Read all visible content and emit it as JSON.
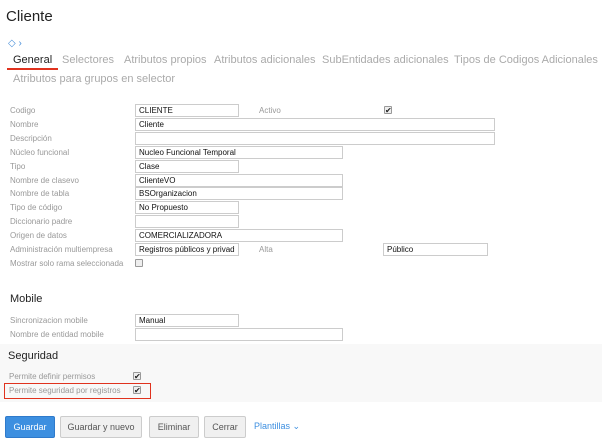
{
  "title": "Cliente",
  "tabs": [
    "General",
    "Selectores",
    "Atributos propios",
    "Atributos adicionales",
    "SubEntidades adicionales",
    "Tipos de Codigos Adicionales",
    "Atributos para grupos en selector"
  ],
  "form": {
    "codigo": {
      "label": "Codigo",
      "value": "CLIENTE"
    },
    "activo": {
      "label": "Activo",
      "checked": true
    },
    "nombre": {
      "label": "Nombre",
      "value": "Cliente"
    },
    "descripcion": {
      "label": "Descripción",
      "value": ""
    },
    "nucleo": {
      "label": "Núcleo funcional",
      "value": "Nucleo Funcional Temporal"
    },
    "tipo": {
      "label": "Tipo",
      "value": "Clase"
    },
    "clasevo": {
      "label": "Nombre de clasevo",
      "value": "ClienteVO"
    },
    "tabla": {
      "label": "Nombre de tabla",
      "value": "BSOrganizacion"
    },
    "tipo_codigo": {
      "label": "Tipo de código",
      "value": "No Propuesto"
    },
    "diccionario": {
      "label": "Diccionario padre",
      "value": ""
    },
    "origen": {
      "label": "Origen de datos",
      "value": "COMERCIALIZADORA"
    },
    "admin": {
      "label": "Administración multiempresa",
      "value": "Registros públicos y privad"
    },
    "alta": {
      "label": "Alta",
      "value": "Público"
    },
    "mostrar": {
      "label": "Mostrar solo rama seleccionada",
      "checked": false
    }
  },
  "mobile": {
    "heading": "Mobile",
    "sync": {
      "label": "Sincronizacion mobile",
      "value": "Manual"
    },
    "entity": {
      "label": "Nombre de entidad mobile",
      "value": ""
    }
  },
  "security": {
    "heading": "Seguridad",
    "permisos": {
      "label": "Permite definir permisos",
      "checked": true
    },
    "registros": {
      "label": "Permite seguridad por registros",
      "checked": true
    }
  },
  "buttons": {
    "save": "Guardar",
    "save_new": "Guardar y nuevo",
    "delete": "Eliminar",
    "close": "Cerrar",
    "templates": "Plantillas"
  },
  "colors": {
    "accent": "#3d8fe0",
    "tab_underline": "#e0321e",
    "highlight": "#e0321e"
  }
}
